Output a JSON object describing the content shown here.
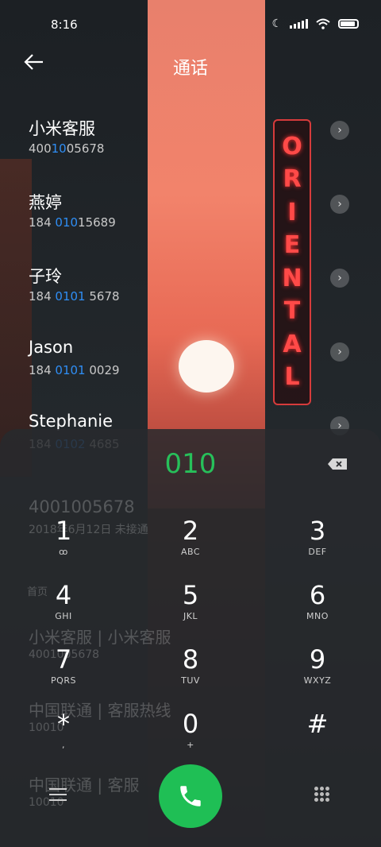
{
  "status": {
    "time": "8:16"
  },
  "header": {
    "title": "通话",
    "back_icon": "arrow-left-icon"
  },
  "contacts": [
    {
      "name": "小米客服",
      "num_pre": "400",
      "num_match": "10",
      "num_post": "05678"
    },
    {
      "name": "燕婷",
      "num_pre": "184 ",
      "num_match": "010",
      "num_post": "15689"
    },
    {
      "name": "子玲",
      "num_pre": "184 ",
      "num_match": "0101",
      "num_post": " 5678"
    },
    {
      "name": "Jason",
      "num_pre": "184 ",
      "num_match": "0101",
      "num_post": " 0029"
    },
    {
      "name": "Stephanie",
      "num_pre": "184 ",
      "num_match": "0102",
      "num_post": " 4685"
    }
  ],
  "ghost_rows": [
    {
      "text": "4001005678"
    },
    {
      "text": "2018年6月12日 未接通"
    },
    {
      "text": "首页"
    },
    {
      "text": "小米客服 | 小米客服"
    },
    {
      "text": "4001005678"
    },
    {
      "text": "中国联通 | 客服热线"
    },
    {
      "text": "10010"
    },
    {
      "text": "中国联通 | 客服"
    },
    {
      "text": "10010"
    }
  ],
  "dialpad": {
    "input": "010",
    "keys": [
      {
        "digit": "1",
        "letters": "ꝏ"
      },
      {
        "digit": "2",
        "letters": "ABC"
      },
      {
        "digit": "3",
        "letters": "DEF"
      },
      {
        "digit": "4",
        "letters": "GHI"
      },
      {
        "digit": "5",
        "letters": "JKL"
      },
      {
        "digit": "6",
        "letters": "MNO"
      },
      {
        "digit": "7",
        "letters": "PQRS"
      },
      {
        "digit": "8",
        "letters": "TUV"
      },
      {
        "digit": "9",
        "letters": "WXYZ"
      },
      {
        "digit": "*",
        "letters": ","
      },
      {
        "digit": "0",
        "letters": "+"
      },
      {
        "digit": "#",
        "letters": ""
      }
    ]
  },
  "neon_sign": [
    "O",
    "R",
    "I",
    "E",
    "N",
    "T",
    "A",
    "L"
  ],
  "colors": {
    "call": "#1fbf55",
    "match": "#2f8ef5",
    "dialed": "#27c05a"
  }
}
